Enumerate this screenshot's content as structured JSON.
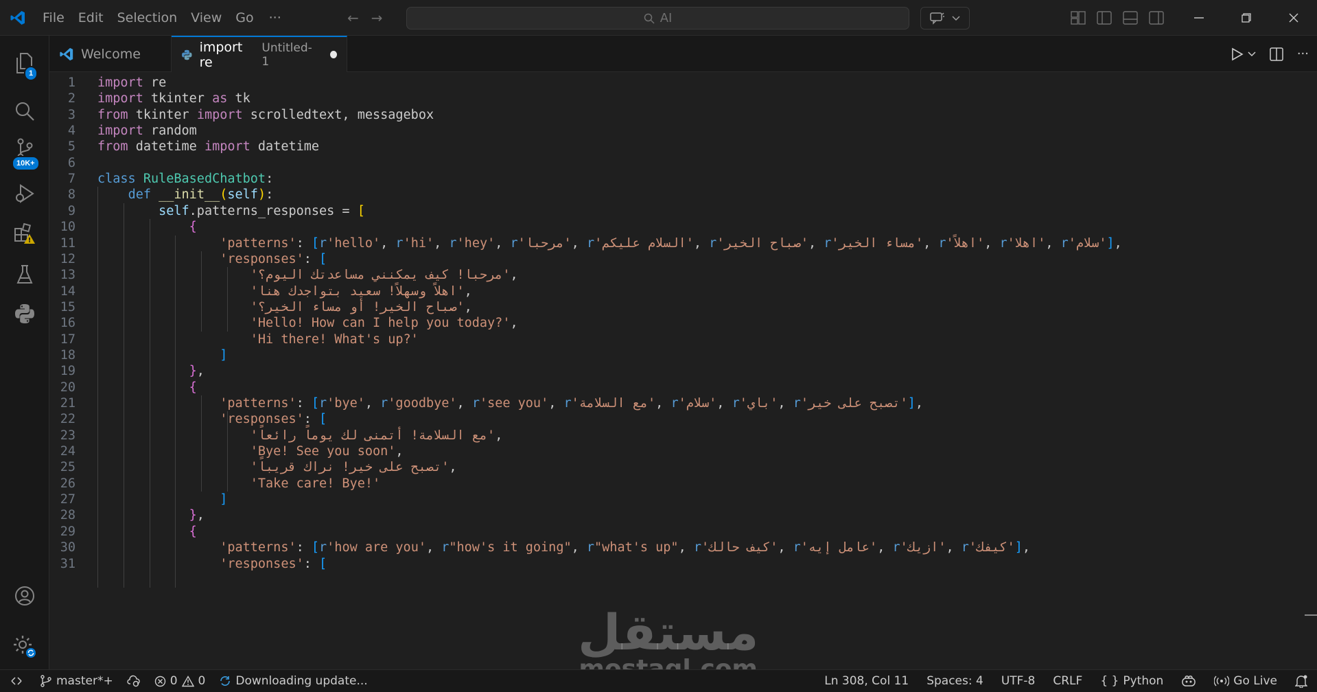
{
  "titlebar": {
    "menu": [
      "File",
      "Edit",
      "Selection",
      "View",
      "Go"
    ],
    "more": "···",
    "search_placeholder": "AI",
    "colors": {
      "brand": "#0078d4",
      "background": "#1f1f1f"
    }
  },
  "activity": {
    "explorer_badge": "1",
    "scm_badge": "10K+"
  },
  "tabs": {
    "welcome": "Welcome",
    "active_label": "import re",
    "active_desc": "Untitled-1"
  },
  "editor": {
    "lines": [
      [
        [
          "kw",
          "import"
        ],
        [
          "",
          " re"
        ]
      ],
      [
        [
          "kw",
          "import"
        ],
        [
          "",
          " tkinter "
        ],
        [
          "kw",
          "as"
        ],
        [
          "",
          " tk"
        ]
      ],
      [
        [
          "kw",
          "from"
        ],
        [
          "",
          " tkinter "
        ],
        [
          "kw",
          "import"
        ],
        [
          "",
          " scrolledtext, messagebox"
        ]
      ],
      [
        [
          "kw",
          "import"
        ],
        [
          "",
          " random"
        ]
      ],
      [
        [
          "kw",
          "from"
        ],
        [
          "",
          " datetime "
        ],
        [
          "kw",
          "import"
        ],
        [
          "",
          " datetime"
        ]
      ],
      [],
      [
        [
          "kw2",
          "class"
        ],
        [
          "",
          " "
        ],
        [
          "cls",
          "RuleBasedChatbot"
        ],
        [
          "",
          ":"
        ]
      ],
      [
        [
          "",
          "    "
        ],
        [
          "kw2",
          "def"
        ],
        [
          "",
          " "
        ],
        [
          "fn",
          "__init__"
        ],
        [
          "b1",
          "("
        ],
        [
          "var",
          "self"
        ],
        [
          "b1",
          ")"
        ],
        [
          "",
          ":"
        ]
      ],
      [
        [
          "",
          "        "
        ],
        [
          "var",
          "self"
        ],
        [
          "",
          ".patterns_responses = "
        ],
        [
          "b1",
          "["
        ]
      ],
      [
        [
          "",
          "            "
        ],
        [
          "b2",
          "{"
        ]
      ],
      [
        [
          "",
          "                "
        ],
        [
          "str",
          "'patterns'"
        ],
        [
          "",
          ": "
        ],
        [
          "b3",
          "["
        ],
        [
          "pre",
          "r"
        ],
        [
          "str",
          "'hello'"
        ],
        [
          "",
          ", "
        ],
        [
          "pre",
          "r"
        ],
        [
          "str",
          "'hi'"
        ],
        [
          "",
          ", "
        ],
        [
          "pre",
          "r"
        ],
        [
          "str",
          "'hey'"
        ],
        [
          "",
          ", "
        ],
        [
          "pre",
          "r"
        ],
        [
          "str",
          "'مرحبا'"
        ],
        [
          "",
          ", "
        ],
        [
          "pre",
          "r"
        ],
        [
          "str",
          "'السلام عليكم'"
        ],
        [
          "",
          ", "
        ],
        [
          "pre",
          "r"
        ],
        [
          "str",
          "'صباح الخير'"
        ],
        [
          "",
          ", "
        ],
        [
          "pre",
          "r"
        ],
        [
          "str",
          "'مساء الخير'"
        ],
        [
          "",
          ", "
        ],
        [
          "pre",
          "r"
        ],
        [
          "str",
          "'اهلاً'"
        ],
        [
          "",
          ", "
        ],
        [
          "pre",
          "r"
        ],
        [
          "str",
          "'اهلا'"
        ],
        [
          "",
          ", "
        ],
        [
          "pre",
          "r"
        ],
        [
          "str",
          "'سلام'"
        ],
        [
          "b3",
          "]"
        ],
        [
          "",
          ","
        ]
      ],
      [
        [
          "",
          "                "
        ],
        [
          "str",
          "'responses'"
        ],
        [
          "",
          ": "
        ],
        [
          "b3",
          "["
        ]
      ],
      [
        [
          "",
          "                    "
        ],
        [
          "str",
          "'مرحبا! كيف يمكنني مساعدتك اليوم؟'"
        ],
        [
          "",
          ","
        ]
      ],
      [
        [
          "",
          "                    "
        ],
        [
          "str",
          "'اهلاً وسهلاً! سعيد بتواجدك هنا'"
        ],
        [
          "",
          ","
        ]
      ],
      [
        [
          "",
          "                    "
        ],
        [
          "str",
          "'صباح الخير! أو مساء الخير؟'"
        ],
        [
          "",
          ","
        ]
      ],
      [
        [
          "",
          "                    "
        ],
        [
          "str",
          "'Hello! How can I help you today?'"
        ],
        [
          "",
          ","
        ]
      ],
      [
        [
          "",
          "                    "
        ],
        [
          "str",
          "'Hi there! What's up?'"
        ]
      ],
      [
        [
          "",
          "                "
        ],
        [
          "b3",
          "]"
        ]
      ],
      [
        [
          "",
          "            "
        ],
        [
          "b2",
          "}"
        ],
        [
          "",
          ","
        ]
      ],
      [
        [
          "",
          "            "
        ],
        [
          "b2",
          "{"
        ]
      ],
      [
        [
          "",
          "                "
        ],
        [
          "str",
          "'patterns'"
        ],
        [
          "",
          ": "
        ],
        [
          "b3",
          "["
        ],
        [
          "pre",
          "r"
        ],
        [
          "str",
          "'bye'"
        ],
        [
          "",
          ", "
        ],
        [
          "pre",
          "r"
        ],
        [
          "str",
          "'goodbye'"
        ],
        [
          "",
          ", "
        ],
        [
          "pre",
          "r"
        ],
        [
          "str",
          "'see you'"
        ],
        [
          "",
          ", "
        ],
        [
          "pre",
          "r"
        ],
        [
          "str",
          "'مع السلامة'"
        ],
        [
          "",
          ", "
        ],
        [
          "pre",
          "r"
        ],
        [
          "str",
          "'سلام'"
        ],
        [
          "",
          ", "
        ],
        [
          "pre",
          "r"
        ],
        [
          "str",
          "'باي'"
        ],
        [
          "",
          ", "
        ],
        [
          "pre",
          "r"
        ],
        [
          "str",
          "'تصبح على خير'"
        ],
        [
          "b3",
          "]"
        ],
        [
          "",
          ","
        ]
      ],
      [
        [
          "",
          "                "
        ],
        [
          "str",
          "'responses'"
        ],
        [
          "",
          ": "
        ],
        [
          "b3",
          "["
        ]
      ],
      [
        [
          "",
          "                    "
        ],
        [
          "str",
          "'مع السلامة! أتمنى لك يوماً رائعاً'"
        ],
        [
          "",
          ","
        ]
      ],
      [
        [
          "",
          "                    "
        ],
        [
          "str",
          "'Bye! See you soon'"
        ],
        [
          "",
          ","
        ]
      ],
      [
        [
          "",
          "                    "
        ],
        [
          "str",
          "'تصبح على خير! نراك قريباً'"
        ],
        [
          "",
          ","
        ]
      ],
      [
        [
          "",
          "                    "
        ],
        [
          "str",
          "'Take care! Bye!'"
        ]
      ],
      [
        [
          "",
          "                "
        ],
        [
          "b3",
          "]"
        ]
      ],
      [
        [
          "",
          "            "
        ],
        [
          "b2",
          "}"
        ],
        [
          "",
          ","
        ]
      ],
      [
        [
          "",
          "            "
        ],
        [
          "b2",
          "{"
        ]
      ],
      [
        [
          "",
          "                "
        ],
        [
          "str",
          "'patterns'"
        ],
        [
          "",
          ": "
        ],
        [
          "b3",
          "["
        ],
        [
          "pre",
          "r"
        ],
        [
          "str",
          "'how are you'"
        ],
        [
          "",
          ", "
        ],
        [
          "pre",
          "r"
        ],
        [
          "str",
          "\"how's it going\""
        ],
        [
          "",
          ", "
        ],
        [
          "pre",
          "r"
        ],
        [
          "str",
          "\"what's up\""
        ],
        [
          "",
          ", "
        ],
        [
          "pre",
          "r"
        ],
        [
          "str",
          "'كيف حالك'"
        ],
        [
          "",
          ", "
        ],
        [
          "pre",
          "r"
        ],
        [
          "str",
          "'عامل إيه'"
        ],
        [
          "",
          ", "
        ],
        [
          "pre",
          "r"
        ],
        [
          "str",
          "'ازيك'"
        ],
        [
          "",
          ", "
        ],
        [
          "pre",
          "r"
        ],
        [
          "str",
          "'كيفك'"
        ],
        [
          "b3",
          "]"
        ],
        [
          "",
          ","
        ]
      ],
      [
        [
          "",
          "                "
        ],
        [
          "str",
          "'responses'"
        ],
        [
          "",
          ": "
        ],
        [
          "b3",
          "["
        ]
      ]
    ]
  },
  "watermark": {
    "arabic": "مستقل",
    "latin": "mostaql.com"
  },
  "status": {
    "branch": "master*+",
    "errors": "0",
    "warnings": "0",
    "update": "Downloading update...",
    "position": "Ln 308, Col 11",
    "spaces": "Spaces: 4",
    "encoding": "UTF-8",
    "eol": "CRLF",
    "language": "Python",
    "golive": "Go Live"
  }
}
